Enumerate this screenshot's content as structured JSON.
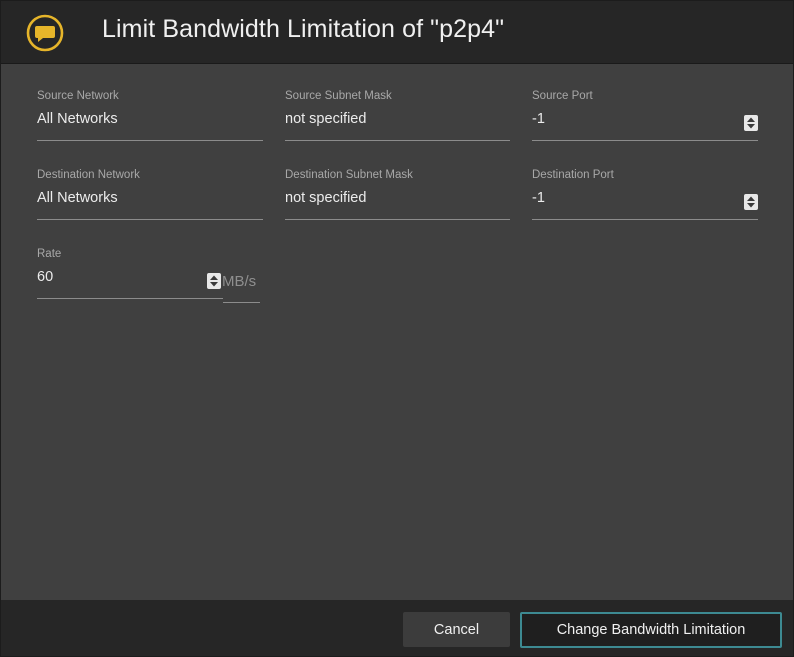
{
  "dialog": {
    "title": "Limit Bandwidth Limitation of \"p2p4\"",
    "icon": "chat-bubble-icon",
    "accent_color": "#e6b52a"
  },
  "fields": {
    "source_network": {
      "label": "Source Network",
      "value": "All Networks"
    },
    "source_subnet_mask": {
      "label": "Source Subnet Mask",
      "value": "not specified"
    },
    "source_port": {
      "label": "Source Port",
      "value": "-1"
    },
    "destination_network": {
      "label": "Destination Network",
      "value": "All Networks"
    },
    "destination_subnet_mask": {
      "label": "Destination Subnet Mask",
      "value": "not specified"
    },
    "destination_port": {
      "label": "Destination Port",
      "value": "-1"
    },
    "rate": {
      "label": "Rate",
      "value": "60",
      "unit": "MB/s"
    }
  },
  "footer": {
    "cancel_label": "Cancel",
    "submit_label": "Change Bandwidth Limitation",
    "submit_border_color": "#3d8a92"
  }
}
